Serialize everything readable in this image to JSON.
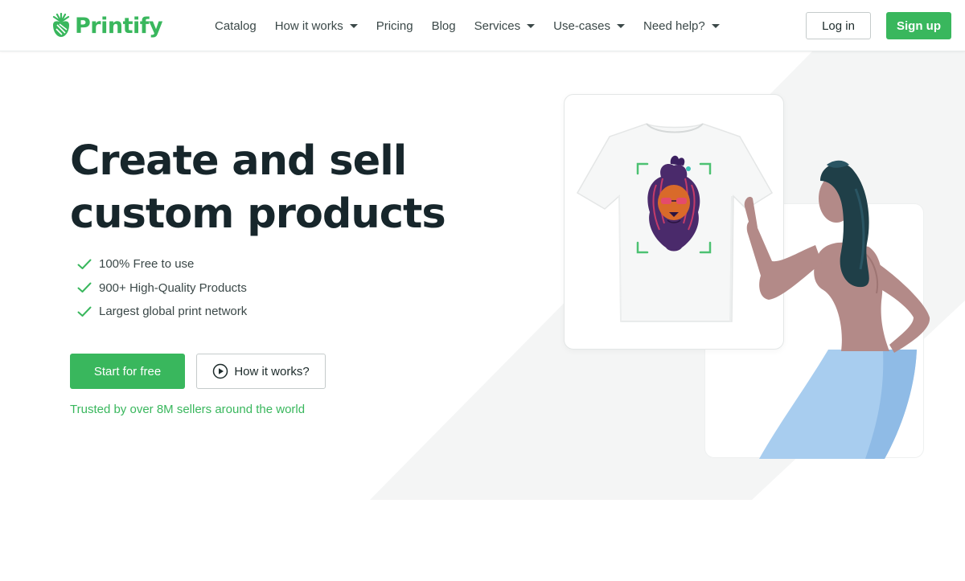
{
  "brand": {
    "name": "Printify",
    "color": "#39b75d"
  },
  "nav": {
    "items": [
      {
        "label": "Catalog",
        "has_dropdown": false
      },
      {
        "label": "How it works",
        "has_dropdown": true
      },
      {
        "label": "Pricing",
        "has_dropdown": false
      },
      {
        "label": "Blog",
        "has_dropdown": false
      },
      {
        "label": "Services",
        "has_dropdown": true
      },
      {
        "label": "Use-cases",
        "has_dropdown": true
      },
      {
        "label": "Need help?",
        "has_dropdown": true
      }
    ]
  },
  "auth": {
    "login_label": "Log in",
    "signup_label": "Sign up"
  },
  "hero": {
    "title_line1": "Create and sell",
    "title_line2": "custom products",
    "features": [
      "100% Free to use",
      "900+ High-Quality Products",
      "Largest global print network"
    ],
    "cta_primary": "Start for free",
    "cta_secondary": "How it works?",
    "trusted": "Trusted by over 8M sellers around the world"
  },
  "icons": {
    "logo": "printify-logo-icon",
    "check": "check-icon",
    "play": "play-circle-icon",
    "caret": "chevron-down-icon"
  },
  "colors": {
    "accent": "#39b75d",
    "text_dark": "#17262b",
    "text_body": "#3b4848",
    "bg_shape": "#f4f5f5",
    "skirt": "#a8cdef",
    "hair": "#1f3f48",
    "skin": "#b38a88"
  }
}
